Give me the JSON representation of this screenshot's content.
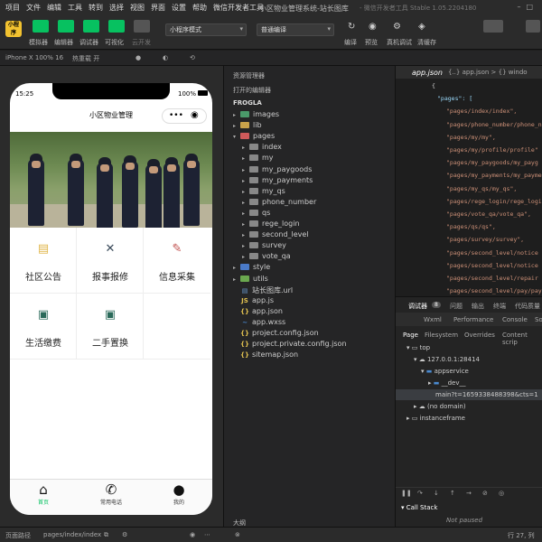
{
  "menu": [
    "项目",
    "文件",
    "编辑",
    "工具",
    "转到",
    "选择",
    "视图",
    "界面",
    "设置",
    "帮助",
    "微信开发者工具"
  ],
  "window_title": "小区物业管理系统-站长图库",
  "window_subtitle": "- 微信开发者工具 Stable 1.05.2204180",
  "toolbar": {
    "labels": [
      "模拟器",
      "编辑器",
      "调试器",
      "可视化",
      "云开发"
    ],
    "mode_select": "小程序模式",
    "compile_select": "普通编译",
    "right_labels": [
      "编译",
      "预览",
      "真机调试",
      "清缓存"
    ]
  },
  "subbar": {
    "device": "iPhone X 100% 16",
    "hotreload": "热重载 开",
    "explorer_title": "资源管理器"
  },
  "phone": {
    "time": "15:25",
    "battery": "100%",
    "nav_title": "小区物业管理",
    "grid": [
      {
        "label": "社区公告",
        "icon": "notice-icon",
        "color": "#e0b64a"
      },
      {
        "label": "报事报修",
        "icon": "repair-icon",
        "color": "#3a4a5a"
      },
      {
        "label": "信息采集",
        "icon": "edit-icon",
        "color": "#c0504d"
      },
      {
        "label": "生活缴费",
        "icon": "payment-icon",
        "color": "#2a6a5a"
      },
      {
        "label": "二手置换",
        "icon": "exchange-icon",
        "color": "#2a6a5a"
      }
    ],
    "tabs": [
      {
        "label": "首页",
        "icon": "home-icon"
      },
      {
        "label": "常用电话",
        "icon": "phone-icon"
      },
      {
        "label": "我的",
        "icon": "user-icon"
      }
    ]
  },
  "explorer": {
    "open_editors": "打开的编辑器",
    "project": "FROGLA",
    "tree": [
      {
        "label": "images",
        "type": "folder",
        "depth": 1,
        "color": "#4a9a6a"
      },
      {
        "label": "lib",
        "type": "folder",
        "depth": 1,
        "color": "#c8a24a"
      },
      {
        "label": "pages",
        "type": "folder",
        "depth": 1,
        "color": "#d05a5a",
        "open": true
      },
      {
        "label": "index",
        "type": "folder",
        "depth": 2,
        "color": "#888"
      },
      {
        "label": "my",
        "type": "folder",
        "depth": 2,
        "color": "#888"
      },
      {
        "label": "my_paygoods",
        "type": "folder",
        "depth": 2,
        "color": "#888"
      },
      {
        "label": "my_payments",
        "type": "folder",
        "depth": 2,
        "color": "#888"
      },
      {
        "label": "my_qs",
        "type": "folder",
        "depth": 2,
        "color": "#888"
      },
      {
        "label": "phone_number",
        "type": "folder",
        "depth": 2,
        "color": "#888"
      },
      {
        "label": "qs",
        "type": "folder",
        "depth": 2,
        "color": "#888"
      },
      {
        "label": "rege_login",
        "type": "folder",
        "depth": 2,
        "color": "#888"
      },
      {
        "label": "second_level",
        "type": "folder",
        "depth": 2,
        "color": "#888"
      },
      {
        "label": "survey",
        "type": "folder",
        "depth": 2,
        "color": "#888"
      },
      {
        "label": "vote_qa",
        "type": "folder",
        "depth": 2,
        "color": "#888"
      },
      {
        "label": "style",
        "type": "folder",
        "depth": 1,
        "color": "#4a7ac8"
      },
      {
        "label": "utils",
        "type": "folder",
        "depth": 1,
        "color": "#6aa84f"
      },
      {
        "label": "站长图库.url",
        "type": "file",
        "depth": 1,
        "glyph": "▤",
        "color": "#6a9ad0"
      },
      {
        "label": "app.js",
        "type": "file",
        "depth": 1,
        "glyph": "JS",
        "color": "#e0c050"
      },
      {
        "label": "app.json",
        "type": "file",
        "depth": 1,
        "glyph": "{}",
        "color": "#e0c050"
      },
      {
        "label": "app.wxss",
        "type": "file",
        "depth": 1,
        "glyph": "~",
        "color": "#4a8ad0"
      },
      {
        "label": "project.config.json",
        "type": "file",
        "depth": 1,
        "glyph": "{}",
        "color": "#e0c050"
      },
      {
        "label": "project.private.config.json",
        "type": "file",
        "depth": 1,
        "glyph": "{}",
        "color": "#e0c050"
      },
      {
        "label": "sitemap.json",
        "type": "file",
        "depth": 1,
        "glyph": "{}",
        "color": "#e0c050"
      }
    ],
    "outline": "大纲"
  },
  "editor": {
    "tab": "app.json",
    "breadcrumb": "{..} app.json > {} windo",
    "lines": [
      "{",
      "\"pages\": [",
      "\"pages/index/index\",",
      "\"pages/phone_number/phone_n",
      "\"pages/my/my\",",
      "\"pages/my/profile/profile\"",
      "\"pages/my_paygoods/my_payg",
      "\"pages/my_payments/my_payme",
      "\"pages/my_qs/my_qs\",",
      "\"pages/rege_login/rege_logi",
      "\"pages/vote_qa/vote_qa\",",
      "\"pages/qs/qs\",",
      "\"pages/survey/survey\",",
      "\"pages/second_level/notice",
      "\"pages/second_level/notice",
      "\"pages/second_level/repair",
      "\"pages/second_level/pay/pay"
    ]
  },
  "devtools": {
    "top_tabs": [
      "调试器",
      "问题",
      "输出",
      "终端",
      "代码质量"
    ],
    "badge": "8",
    "panels": [
      "Wxml",
      "Performance",
      "Console",
      "So"
    ],
    "sub_tabs": [
      "Page",
      "Filesystem",
      "Overrides",
      "Content scrip"
    ],
    "tree": [
      "top",
      "127.0.0.1:28414",
      "appservice",
      "__dev__",
      "main?t=1659338488398&cts=1",
      "(no domain)",
      "instanceframe"
    ],
    "call_stack": "Call Stack",
    "not_paused": "Not paused"
  },
  "statusbar": {
    "path_label": "页面路径",
    "path": "pages/index/index",
    "position": "行 27, 列"
  }
}
